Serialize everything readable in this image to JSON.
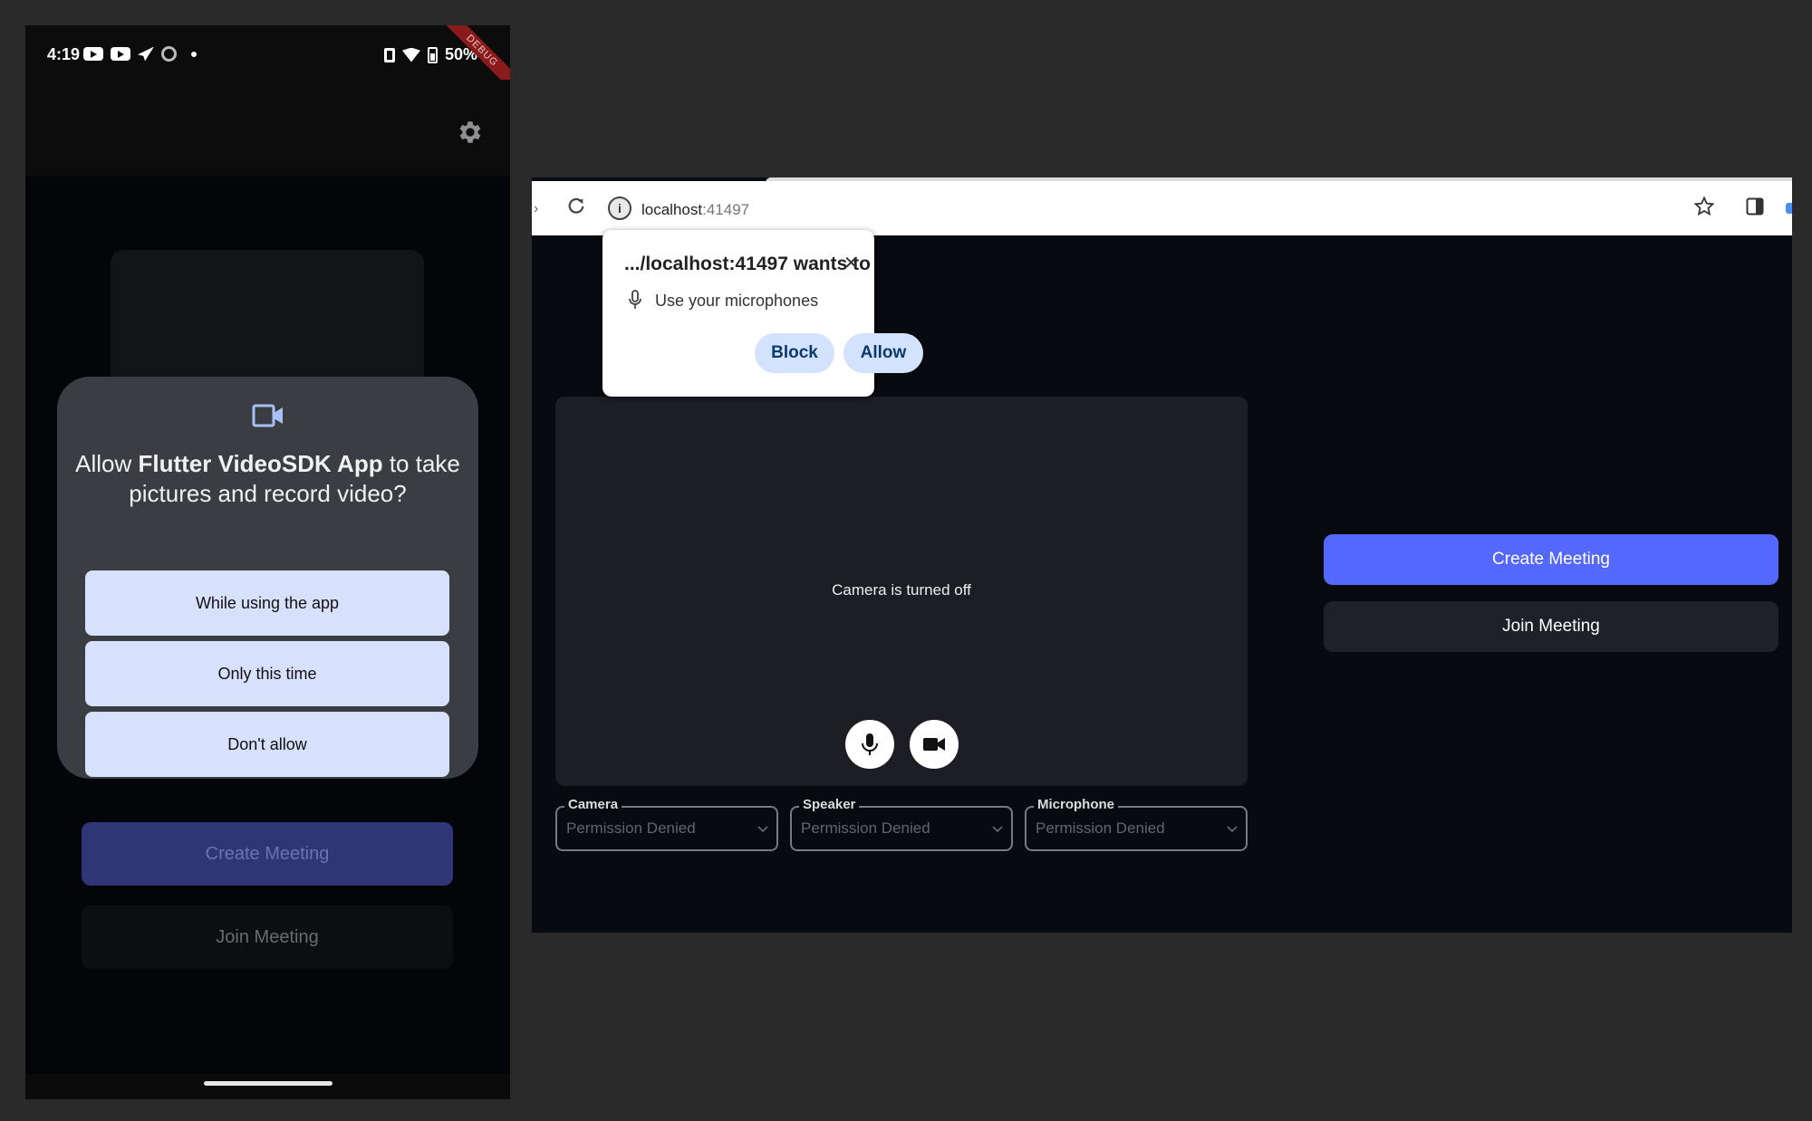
{
  "phone": {
    "status": {
      "time": "4:19",
      "battery": "50%",
      "debug_banner": "DEBUG"
    },
    "dialog": {
      "title_pre": "Allow ",
      "title_app": "Flutter VideoSDK App",
      "title_post": " to take pictures and record video?",
      "options": [
        "While using the app",
        "Only this time",
        "Don't allow"
      ]
    },
    "create_label": "Create Meeting",
    "join_label": "Join Meeting"
  },
  "browser": {
    "url_host": "localhost",
    "url_port": ":41497",
    "popup": {
      "title": ".../localhost:41497 wants to",
      "close": "✕",
      "permission": "Use your microphones",
      "block": "Block",
      "allow": "Allow"
    },
    "preview": {
      "camera_off": "Camera is turned off"
    },
    "dropdowns": [
      {
        "label": "Camera",
        "value": "Permission Denied"
      },
      {
        "label": "Speaker",
        "value": "Permission Denied"
      },
      {
        "label": "Microphone",
        "value": "Permission Denied"
      }
    ],
    "create_label": "Create Meeting",
    "join_label": "Join Meeting"
  },
  "colors": {
    "accent": "#5568fe",
    "permission_button": "#d8e1fc",
    "popup_button": "#d3e3fd"
  }
}
